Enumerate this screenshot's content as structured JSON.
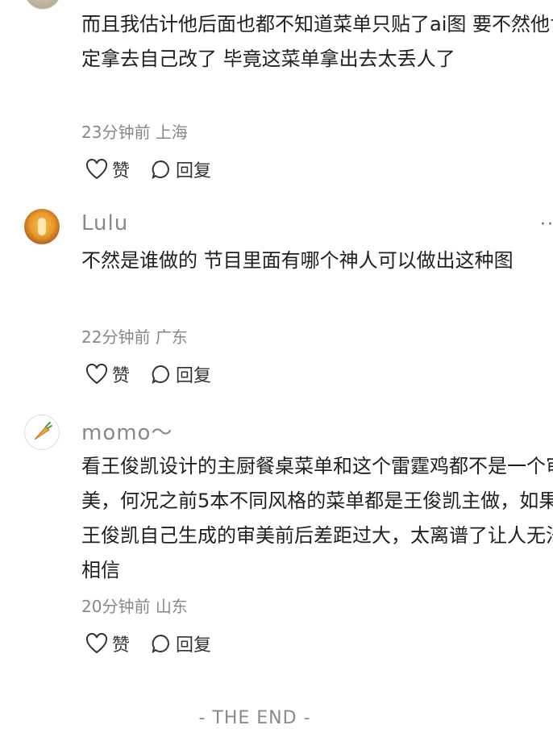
{
  "comments": [
    {
      "text": "而且我估计他后面也都不知道菜单只贴了ai图 要不然他肯定拿去自己改了 毕竟这菜单拿出去太丢人了",
      "time": "23分钟前",
      "location": "上海",
      "like_label": "赞",
      "reply_label": "回复"
    },
    {
      "username": "Lulu",
      "text": "不然是谁做的 节目里面有哪个神人可以做出这种图",
      "time": "22分钟前",
      "location": "广东",
      "like_label": "赞",
      "reply_label": "回复"
    },
    {
      "username": "momo～",
      "text": "看王俊凯设计的主厨餐桌菜单和这个雷霆鸡都不是一个审美，何况之前5本不同风格的菜单都是王俊凯主做，如果是王俊凯自己生成的审美前后差距过大，太离谱了让人无法相信",
      "time": "20分钟前",
      "location": "山东",
      "like_label": "赞",
      "reply_label": "回复"
    }
  ],
  "footer": {
    "end_label": "- THE END -"
  },
  "icons": {
    "like": "heart-outline-icon",
    "reply": "speech-bubble-icon",
    "more": "more-dots-icon"
  }
}
